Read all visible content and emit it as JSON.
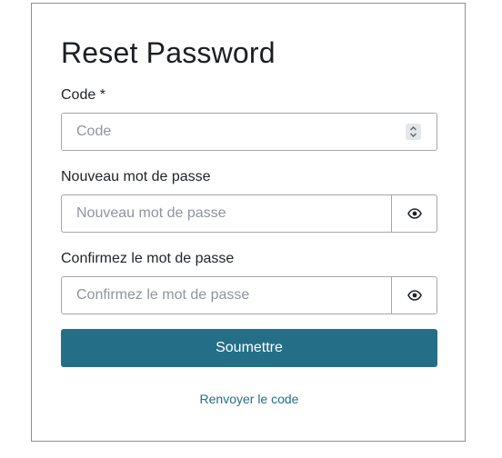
{
  "form": {
    "title": "Reset Password",
    "code": {
      "label": "Code *",
      "placeholder": "Code",
      "value": ""
    },
    "new_password": {
      "label": "Nouveau mot de passe",
      "placeholder": "Nouveau mot de passe",
      "value": "",
      "toggle_icon": "eye-icon"
    },
    "confirm_password": {
      "label": "Confirmez le mot de passe",
      "placeholder": "Confirmez le mot de passe",
      "value": "",
      "toggle_icon": "eye-icon"
    },
    "submit_label": "Soumettre",
    "resend_label": "Renvoyer le code"
  },
  "colors": {
    "primary": "#246f87",
    "border": "#a3a7ad",
    "card_border": "#8d8f97"
  }
}
